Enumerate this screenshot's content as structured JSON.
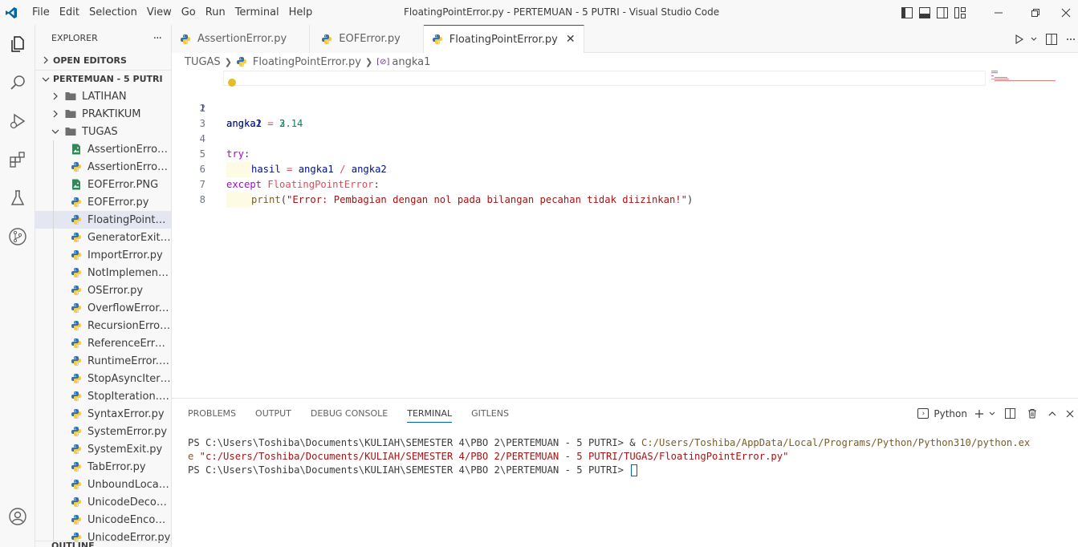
{
  "titlebar": {
    "menu": [
      "File",
      "Edit",
      "Selection",
      "View",
      "Go",
      "Run",
      "Terminal",
      "Help"
    ],
    "window_title": "FloatingPointError.py - PERTEMUAN - 5 PUTRI - Visual Studio Code"
  },
  "sidebar": {
    "header": "EXPLORER",
    "more": "···",
    "open_editors": "OPEN EDITORS",
    "workspace": "PERTEMUAN - 5 PUTRI",
    "folders": [
      {
        "label": "LATIHAN",
        "expanded": false
      },
      {
        "label": "PRAKTIKUM",
        "expanded": false
      },
      {
        "label": "TUGAS",
        "expanded": true
      }
    ],
    "files": [
      {
        "label": "AssertionError.P...",
        "type": "image"
      },
      {
        "label": "AssertionError.py",
        "type": "python"
      },
      {
        "label": "EOFError.PNG",
        "type": "image"
      },
      {
        "label": "EOFError.py",
        "type": "python"
      },
      {
        "label": "FloatingPointErr...",
        "type": "python",
        "selected": true
      },
      {
        "label": "GeneratorExit.py",
        "type": "python"
      },
      {
        "label": "ImportError.py",
        "type": "python"
      },
      {
        "label": "NotImplemente...",
        "type": "python"
      },
      {
        "label": "OSError.py",
        "type": "python"
      },
      {
        "label": "OverflowError.py",
        "type": "python"
      },
      {
        "label": "RecursionError.py",
        "type": "python"
      },
      {
        "label": "ReferenceError.py",
        "type": "python"
      },
      {
        "label": "RuntimeError.py",
        "type": "python"
      },
      {
        "label": "StopAsyncIterati...",
        "type": "python"
      },
      {
        "label": "StopIteration.py",
        "type": "python"
      },
      {
        "label": "SyntaxError.py",
        "type": "python"
      },
      {
        "label": "SystemError.py",
        "type": "python"
      },
      {
        "label": "SystemExit.py",
        "type": "python"
      },
      {
        "label": "TabError.py",
        "type": "python"
      },
      {
        "label": "UnboundLocalEr...",
        "type": "python"
      },
      {
        "label": "UnicodeDecode...",
        "type": "python"
      },
      {
        "label": "UnicodeEncode...",
        "type": "python"
      },
      {
        "label": "UnicodeError.py",
        "type": "python"
      }
    ],
    "outline": "OUTLINE"
  },
  "tabs": [
    {
      "label": "AssertionError.py",
      "active": false
    },
    {
      "label": "EOFError.py",
      "active": false
    },
    {
      "label": "FloatingPointError.py",
      "active": true,
      "close": "✕"
    }
  ],
  "breadcrumb": {
    "folder": "TUGAS",
    "file": "FloatingPointError.py",
    "symbol_icon": "[⊘]",
    "symbol": "angka1"
  },
  "editor": {
    "line_numbers": [
      "1",
      "2",
      "3",
      "4",
      "5",
      "6",
      "7",
      "8"
    ],
    "code": {
      "l1_var": "angka1",
      "l1_op": " = ",
      "l1_num": "3.14",
      "l2_var": "angka2",
      "l2_op": " = ",
      "l2_num": "2",
      "l4_kw": "try",
      "l4_colon": ":",
      "l5_var": "hasil",
      "l5_eq": " = ",
      "l5_a": "angka1",
      "l5_div": " / ",
      "l5_b": "angka2",
      "l6_kw": "except",
      "l6_cls": "FloatingPointError",
      "l6_colon": ":",
      "l7_fn": "print",
      "l7_open": "(",
      "l7_str": "\"Error: Pembagian dengan nol pada bilangan pecahan tidak diizinkan!\"",
      "l7_close": ")"
    }
  },
  "panel": {
    "tabs": [
      "PROBLEMS",
      "OUTPUT",
      "DEBUG CONSOLE",
      "TERMINAL",
      "GITLENS"
    ],
    "active_tab": "TERMINAL",
    "profile": "Python",
    "terminal": {
      "line1_prompt": "PS C:\\Users\\Toshiba\\Documents\\KULIAH\\SEMESTER 4\\PBO 2\\PERTEMUAN - 5 PUTRI> & ",
      "line1_path": "C:/Users/Toshiba/AppData/Local/Programs/Python/Python310/python.ex",
      "line2_path": "e",
      "line2_str": " \"c:/Users/Toshiba/Documents/KULIAH/SEMESTER 4/PBO 2/PERTEMUAN - 5 PUTRI/TUGAS/FloatingPointError.py\"",
      "line3_prompt": "PS C:\\Users\\Toshiba\\Documents\\KULIAH\\SEMESTER 4\\PBO 2\\PERTEMUAN - 5 PUTRI> "
    }
  },
  "colors": {
    "accent": "#005fb8",
    "python_blue": "#3572a5",
    "python_yellow": "#f7c948",
    "image_green": "#2e8b57"
  }
}
